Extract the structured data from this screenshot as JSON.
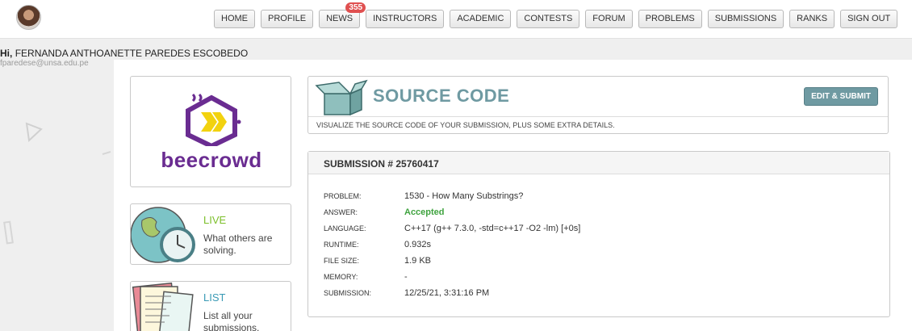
{
  "nav": {
    "items": [
      {
        "label": "HOME"
      },
      {
        "label": "PROFILE"
      },
      {
        "label": "NEWS",
        "badge": "355"
      },
      {
        "label": "INSTRUCTORS"
      },
      {
        "label": "ACADEMIC"
      },
      {
        "label": "CONTESTS"
      },
      {
        "label": "FORUM"
      },
      {
        "label": "PROBLEMS"
      },
      {
        "label": "SUBMISSIONS"
      },
      {
        "label": "RANKS"
      },
      {
        "label": "SIGN OUT"
      }
    ]
  },
  "user": {
    "greeting": "Hi,",
    "name": "FERNANDA ANTHOANETTE PAREDES ESCOBEDO",
    "email": "fparedese@unsa.edu.pe"
  },
  "logo": {
    "text": "beecrowd"
  },
  "sidebar": {
    "live": {
      "title": "LIVE",
      "description": "What others are solving."
    },
    "list": {
      "title": "LIST",
      "description": "List all your submissions."
    }
  },
  "header": {
    "title": "SOURCE CODE",
    "edit_button": "EDIT & SUBMIT",
    "description": "VISUALIZE THE SOURCE CODE OF YOUR SUBMISSION, PLUS SOME EXTRA DETAILS."
  },
  "submission": {
    "title": "SUBMISSION # 25760417",
    "details": [
      {
        "label": "PROBLEM:",
        "value": "1530 - How Many Substrings?"
      },
      {
        "label": "ANSWER:",
        "value": "Accepted"
      },
      {
        "label": "LANGUAGE:",
        "value": "C++17 (g++ 7.3.0, -std=c++17 -O2 -lm) [+0s]"
      },
      {
        "label": "RUNTIME:",
        "value": "0.932s"
      },
      {
        "label": "FILE SIZE:",
        "value": "1.9 KB"
      },
      {
        "label": "MEMORY:",
        "value": "-"
      },
      {
        "label": "SUBMISSION:",
        "value": "12/25/21, 3:31:16 PM"
      }
    ]
  },
  "colors": {
    "brand_purple": "#6a2c91",
    "brand_yellow": "#f2d20f",
    "accent_teal": "#6f9aa2",
    "live_green": "#7cbf2a",
    "list_blue": "#3a9ab5",
    "accepted_green": "#3fa33f",
    "badge_red": "#e05050"
  }
}
